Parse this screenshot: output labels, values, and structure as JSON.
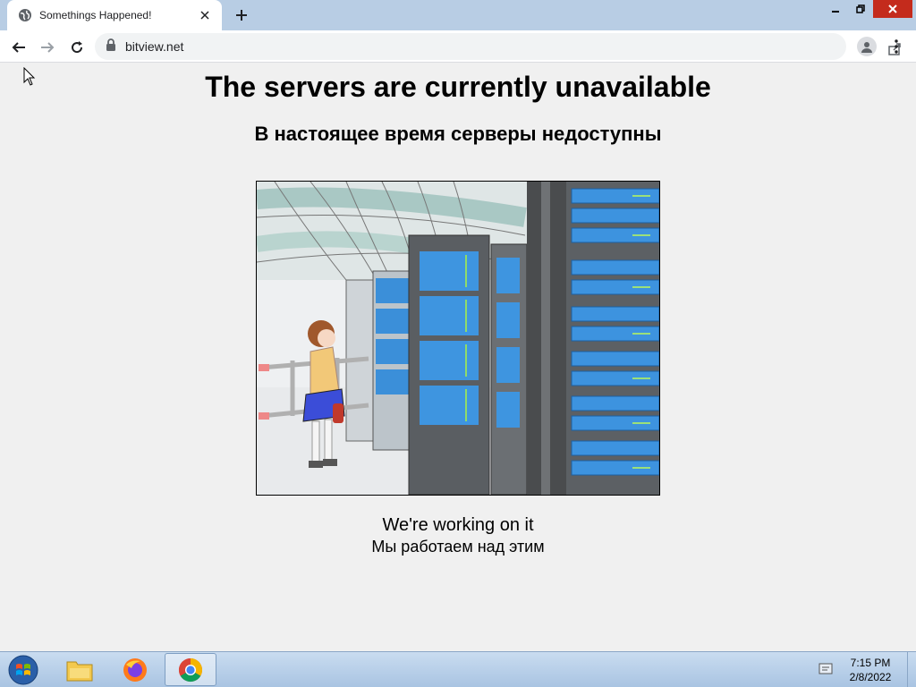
{
  "browser": {
    "tab_title": "Somethings Happened!",
    "url": "bitview.net"
  },
  "page": {
    "heading_en": "The servers are currently unavailable",
    "heading_ru": "В настоящее время серверы недоступны",
    "message_en": "We're working on it",
    "message_ru": "Мы работаем над этим",
    "illustration": "server-room-illustration"
  },
  "taskbar": {
    "apps": [
      "file-explorer",
      "firefox",
      "chrome"
    ],
    "active_app": "chrome",
    "time": "7:15 PM",
    "date": "2/8/2022"
  },
  "colors": {
    "tabbar": "#b8cde4",
    "page_bg": "#f0f0f0",
    "close_red": "#c42b1c"
  }
}
